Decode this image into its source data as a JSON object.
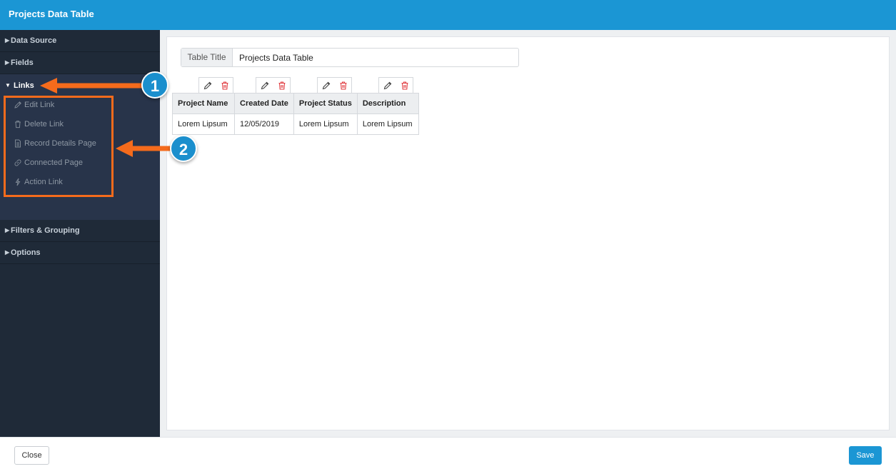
{
  "header": {
    "title": "Projects Data Table"
  },
  "sidebar": {
    "sections": [
      {
        "label": "Data Source"
      },
      {
        "label": "Fields"
      },
      {
        "label": "Links"
      },
      {
        "label": "Filters & Grouping"
      },
      {
        "label": "Options"
      }
    ],
    "links_items": [
      {
        "label": "Edit Link",
        "icon": "pencil-icon"
      },
      {
        "label": "Delete Link",
        "icon": "trash-icon"
      },
      {
        "label": "Record Details Page",
        "icon": "document-icon"
      },
      {
        "label": "Connected Page",
        "icon": "link-icon"
      },
      {
        "label": "Action Link",
        "icon": "lightning-icon"
      }
    ]
  },
  "callouts": {
    "one": "1",
    "two": "2"
  },
  "main": {
    "table_title_label": "Table Title",
    "table_title_value": "Projects Data Table",
    "table": {
      "headers": [
        "Project Name",
        "Created Date",
        "Project Status",
        "Description"
      ],
      "rows": [
        [
          "Lorem Lipsum",
          "12/05/2019",
          "Lorem Lipsum",
          "Lorem Lipsum"
        ]
      ]
    }
  },
  "footer": {
    "close_label": "Close",
    "save_label": "Save"
  },
  "colors": {
    "header_bg": "#1b96d4",
    "sidebar_bg": "#1f2a38",
    "annotation_orange": "#f56b1c",
    "badge_blue": "#1b8fcd",
    "delete_red": "#e0393e"
  }
}
